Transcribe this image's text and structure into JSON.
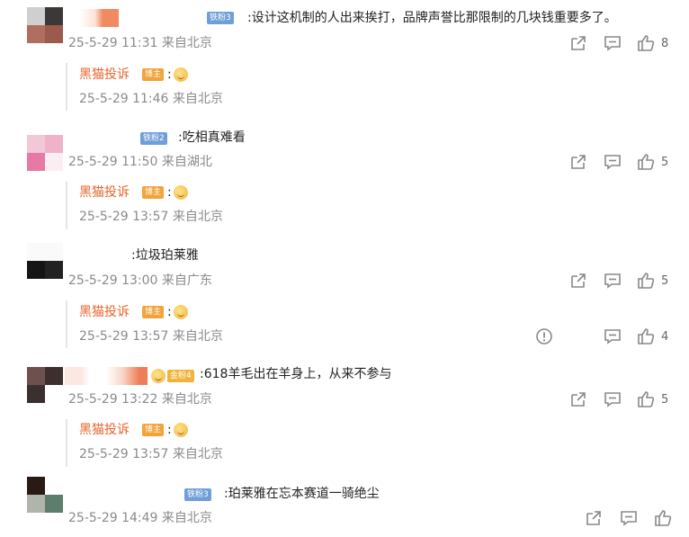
{
  "comments": [
    {
      "level_badge": "铁粉3",
      "text": ":设计这机制的人出来挨打，品牌声誉比那限制的几块钱重要多了。",
      "meta": "25-5-29 11:31 来自北京",
      "likes": "8",
      "reply": {
        "name": "黑猫投诉",
        "host": "博主",
        "colon": ":",
        "meta": "25-5-29 11:46 来自北京"
      }
    },
    {
      "level_badge": "铁粉2",
      "text": ":吃相真难看",
      "meta": "25-5-29 11:50 来自湖北",
      "likes": "5",
      "reply": {
        "name": "黑猫投诉",
        "host": "博主",
        "colon": ":",
        "meta": "25-5-29 13:57 来自北京"
      }
    },
    {
      "level_badge": "",
      "text": ":垃圾珀莱雅",
      "meta": "25-5-29 13:00 来自广东",
      "likes": "5",
      "reply": {
        "name": "黑猫投诉",
        "host": "博主",
        "colon": ":",
        "meta": "25-5-29 13:57 来自北京",
        "likes": "4"
      }
    },
    {
      "level_badge": "金粉4",
      "text": ":618羊毛出在羊身上，从来不参与",
      "meta": "25-5-29 13:22 来自北京",
      "likes": "5",
      "reply": {
        "name": "黑猫投诉",
        "host": "博主",
        "colon": ":",
        "meta": "25-5-29 13:57 来自北京"
      }
    },
    {
      "level_badge": "铁粉3",
      "text": ":珀莱雅在忘本赛道一骑绝尘",
      "meta": "25-5-29 14:49 来自北京",
      "likes": ""
    }
  ],
  "icons": {
    "share": "share-icon",
    "comment": "comment-icon",
    "like": "thumbs-up-icon",
    "report": "report-icon"
  },
  "colors": {
    "reply_name": "#e8632a",
    "host_badge": "#f2a33b",
    "fan_badge": "#6f9fd8",
    "gold_badge": "#f0b43c",
    "meta": "#8a8a8a"
  }
}
